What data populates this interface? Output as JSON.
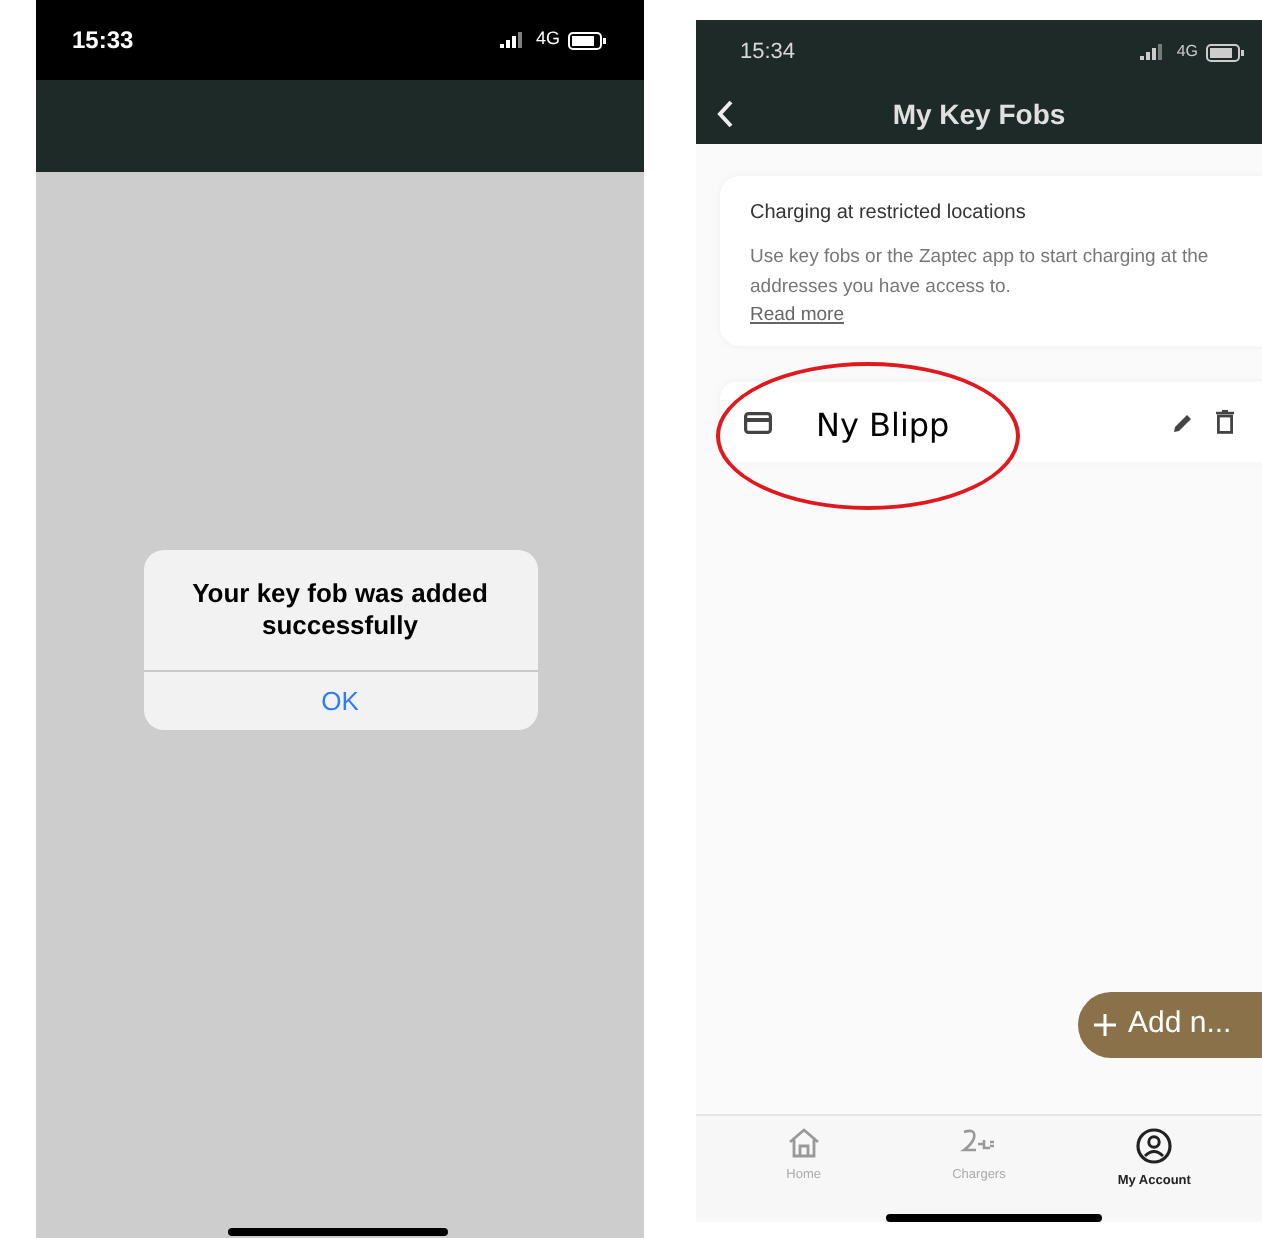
{
  "left_screen": {
    "status_bar": {
      "time": "15:33",
      "network": "4G"
    },
    "alert": {
      "message": "Your key fob was added successfully",
      "button": "OK"
    }
  },
  "right_screen": {
    "status_bar": {
      "time": "15:34",
      "network": "4G"
    },
    "header": {
      "title": "My Key Fobs"
    },
    "info_card": {
      "title": "Charging at restricted locations",
      "text": "Use key fobs or the Zaptec app to start charging at the addresses you have access to.",
      "link": "Read more"
    },
    "key_fobs": [
      {
        "name": "Ny Blipp",
        "highlighted": true
      }
    ],
    "add_button": {
      "label": "Add n..."
    },
    "tabs": [
      {
        "label": "Home",
        "kind": "home",
        "selected": false
      },
      {
        "label": "Chargers",
        "kind": "chargers",
        "selected": false
      },
      {
        "label": "My Account",
        "kind": "account",
        "selected": true
      }
    ]
  }
}
